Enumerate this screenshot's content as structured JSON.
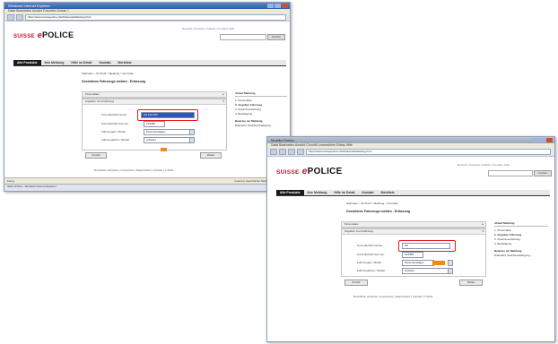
{
  "back_window": {
    "title": "Windows Internet Explorer",
    "menu": "Datei  Bearbeiten  Ansicht  Favoriten  Extras  ?",
    "address": "https://www.suissepolice.ch/ePolice/de/Meldung.html",
    "logo": {
      "suisse": "SUISSE",
      "e": "e",
      "police": "POLICE"
    },
    "top_info": "Deutsch  |  Français  |  Italiano  |  Kontakt  |  Hilfe",
    "go_label": "Suchen",
    "tabs": [
      "Alle Produkte",
      "Ihre Meldung",
      "Hilfe im Detail",
      "Kontakt",
      "Merkliste"
    ],
    "breadcrumb": "Startseite > Ihr Profil > Meldung > Formular",
    "section_title": "Gestohlene Fahrzeuge melden - Erfassung",
    "panel1_title": "Personalien",
    "panel2_title": "Angaben zum Fahrzeug",
    "fields": [
      {
        "label": "Kontrollschild Kanton:",
        "value": "ZH 123 456"
      },
      {
        "label": "Kontrollschild Nummer:",
        "value": "123456"
      },
      {
        "label": "Fahrzeugart / Marke:",
        "value": "Personenwagen"
      },
      {
        "label": "Fahrzeugfarbe / Modell:",
        "value": "schwarz"
      }
    ],
    "btn_back": "Zurück",
    "btn_next": "Weiter",
    "side_heading": "Ablauf Meldung",
    "side_items": [
      "1. Personalien",
      "2. Angaben Fahrzeug",
      "3. Zusammenfassung",
      "4. Bestätigung"
    ],
    "side_heading2": "Beweise zur Meldung",
    "side_text": "Diebstahl, Sachbeschädigung ...",
    "footer": "Rechtliche Hinweise  |  Impressum  |  Datenschutz  |  Kontakt  |  © 2024",
    "status": "Fertig",
    "status_right": "Internet | Geschützter Modus: Inaktiv    100%",
    "taskbar": "Start   ePolice - Windows Internet Explorer"
  },
  "front_window": {
    "title": "Mozilla Firefox",
    "menu": "Datei  Bearbeiten  Ansicht  Chronik  Lesezeichen  Extras  Hilfe",
    "address": "https://www.suissepolice.ch/ePolice/de/Meldung.html",
    "logo": {
      "suisse": "SUISSE",
      "e": "e",
      "police": "POLICE"
    },
    "top_info": "Deutsch  |  Français  |  Italiano  |  Kontakt  |  Hilfe",
    "go_label": "Suchen",
    "tabs": [
      "Alle Produkte",
      "Ihre Meldung",
      "Hilfe im Detail",
      "Kontakt",
      "Merkliste"
    ],
    "breadcrumb": "Startseite > Ihr Profil > Meldung > Formular",
    "section_title": "Gestohlene Fahrzeuge melden - Erfassung",
    "panel1_title": "Personalien",
    "panel2_title": "Angaben zum Fahrzeug",
    "fields": [
      {
        "label": "Kontrollschild Kanton:",
        "value": "ZH"
      },
      {
        "label": "Kontrollschild Nummer:",
        "value": "123456"
      },
      {
        "label": "Fahrzeugart / Marke:",
        "value": "Personenwagen"
      },
      {
        "label": "Fahrzeugfarbe / Modell:",
        "value": "schwarz"
      }
    ],
    "btn_back": "Zurück",
    "btn_next": "Weiter",
    "side_heading": "Ablauf Meldung",
    "side_items": [
      "1. Personalien",
      "2. Angaben Fahrzeug",
      "3. Zusammenfassung",
      "4. Bestätigung"
    ],
    "side_heading2": "Beweise zur Meldung",
    "side_text": "Diebstahl, Sachbeschädigung ...",
    "footer": "Rechtliche Hinweise  |  Impressum  |  Datenschutz  |  Kontakt  |  © 2024"
  },
  "colors": {
    "brand_red": "#c8102e",
    "highlight_ring": "#e31c1c",
    "marker_orange": "#f28a1b",
    "selection_blue": "#2f55b8"
  }
}
